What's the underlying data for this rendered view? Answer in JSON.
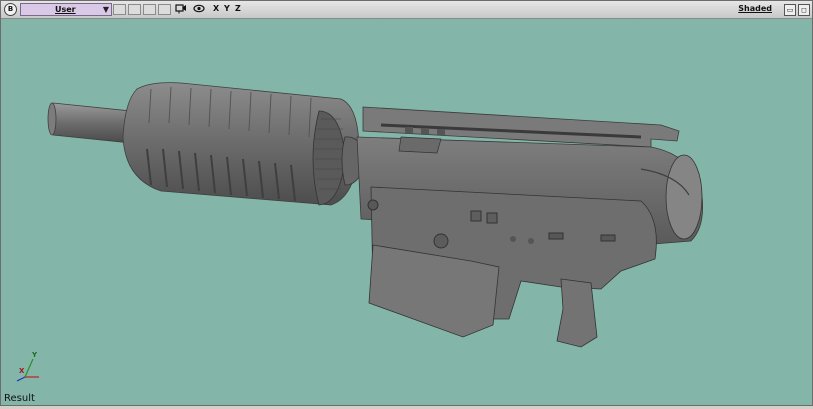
{
  "titlebar": {
    "corner_button": "B",
    "camera": "User",
    "axes": [
      "X",
      "Y",
      "Z"
    ],
    "display_mode": "Shaded"
  },
  "viewport": {
    "background_color": "#83b6a8",
    "model_color": "#6f6f6f",
    "gizmo_axes": [
      "Y",
      "X"
    ]
  },
  "status": {
    "result_label": "Result"
  },
  "icons": [
    "camera-icon",
    "eye-icon",
    "maximize-icon",
    "restore-icon"
  ]
}
